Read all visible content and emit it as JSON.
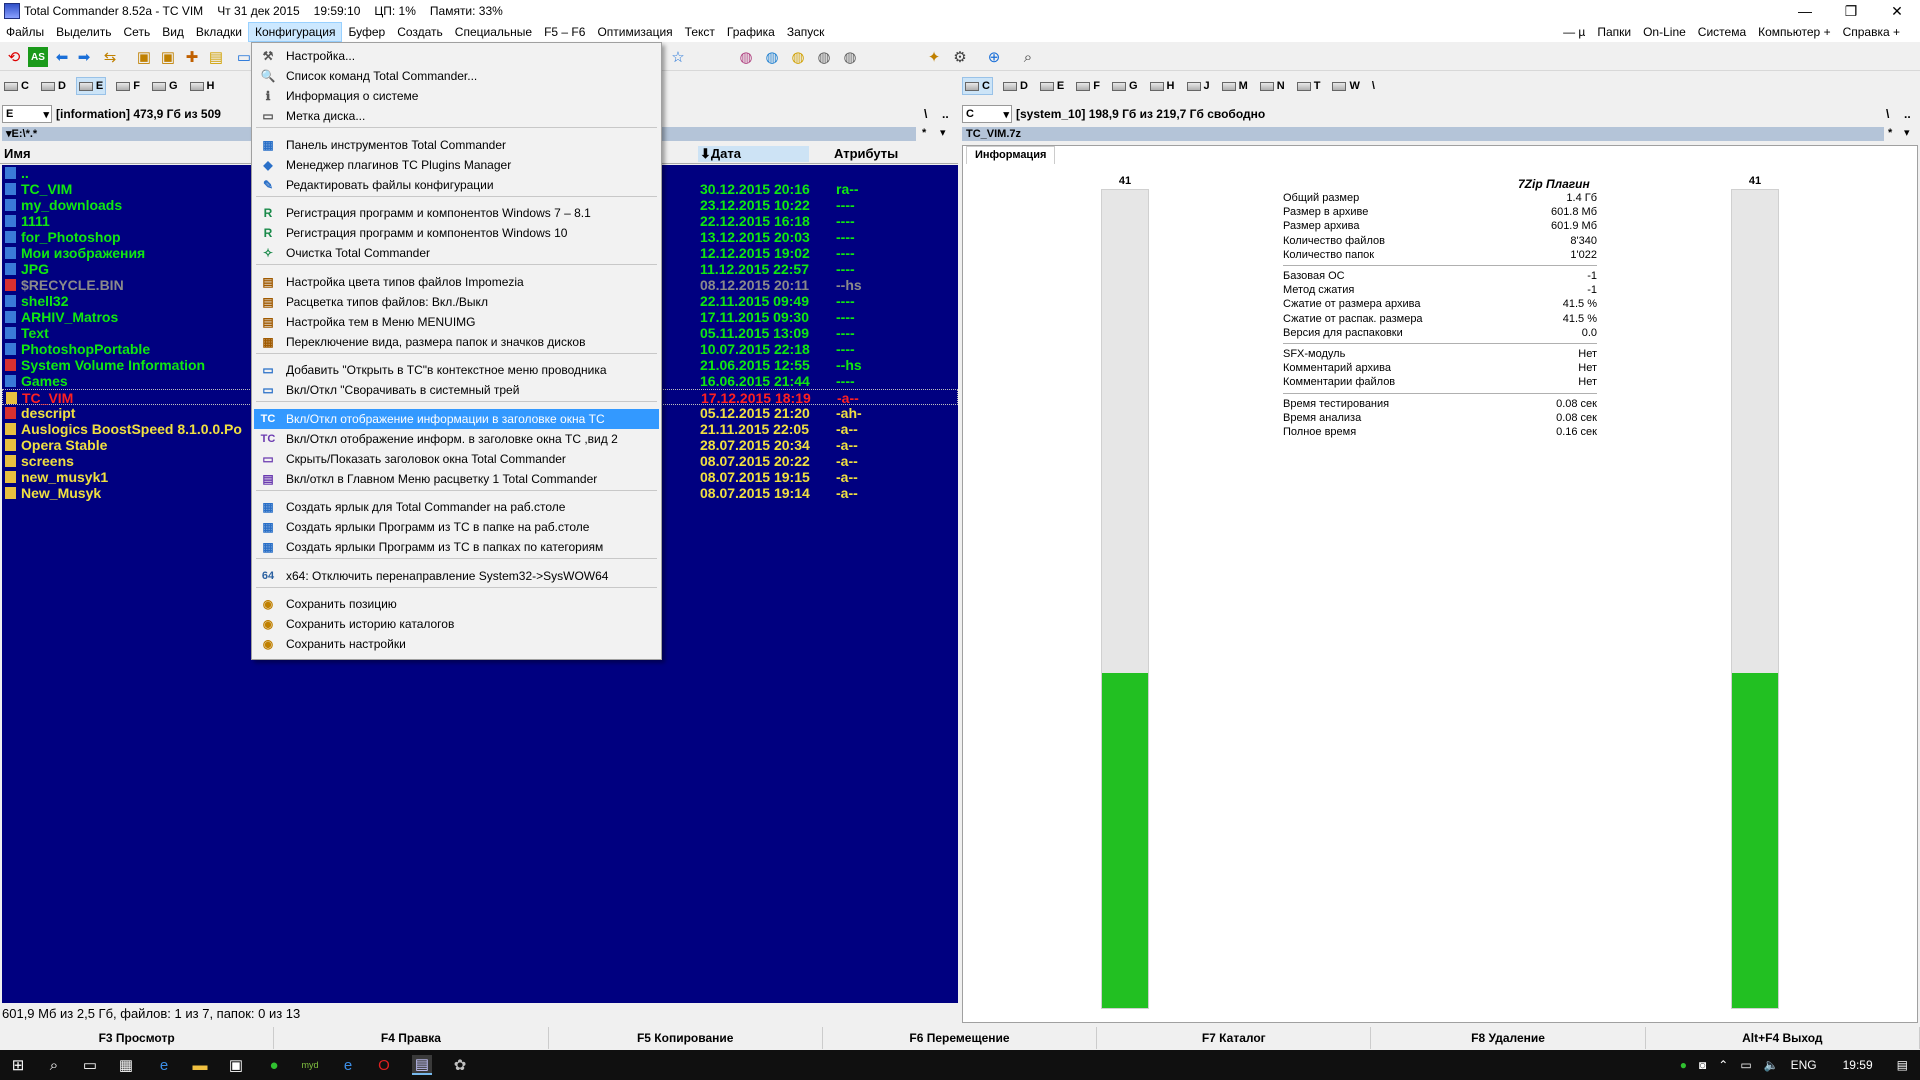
{
  "titlebar": {
    "title": "Total Commander 8.52a - TC VIM",
    "date": "Чт 31 дек 2015",
    "time": "19:59:10",
    "cpu": "ЦП: 1%",
    "memory": "Памяти: 33%",
    "minimize": "—",
    "restore": "❐",
    "close": "✕"
  },
  "menubar": {
    "items": [
      "Файлы",
      "Выделить",
      "Сеть",
      "Вид",
      "Вкладки",
      "Конфигурация",
      "Буфер",
      "Создать",
      "Специальные",
      "F5 – F6",
      "Оптимизация",
      "Текст",
      "Графика",
      "Запуск"
    ],
    "right": [
      "— µ",
      "Папки",
      "On-Line",
      "Система",
      "Компьютер +",
      "Справка +"
    ]
  },
  "left": {
    "drives": [
      "C",
      "D",
      "E",
      "F",
      "G",
      "H"
    ],
    "drive_select": "E",
    "volume_info": "[information]  473,9 Гб из 509",
    "path": "▾E:\\*.*",
    "root_btn": "\\",
    "up_btn": "..",
    "star": "*",
    "headers": {
      "name": "Имя",
      "date": "Дата",
      "attrs": "Атрибуты"
    },
    "files": [
      {
        "name": "..",
        "date": "",
        "attr": "",
        "color": "green",
        "icon": "up"
      },
      {
        "name": "TC_VIM",
        "date": "30.12.2015 20:16",
        "attr": "ra--",
        "color": "green",
        "icon": "folder"
      },
      {
        "name": "my_downloads",
        "date": "23.12.2015 10:22",
        "attr": "----",
        "color": "green",
        "icon": "folder"
      },
      {
        "name": "1111",
        "date": "22.12.2015 16:18",
        "attr": "----",
        "color": "green",
        "icon": "folder"
      },
      {
        "name": "for_Photoshop",
        "date": "13.12.2015 20:03",
        "attr": "----",
        "color": "green",
        "icon": "folder"
      },
      {
        "name": "Мои изображения",
        "date": "12.12.2015 19:02",
        "attr": "----",
        "color": "green",
        "icon": "folder"
      },
      {
        "name": "JPG",
        "date": "11.12.2015 22:57",
        "attr": "----",
        "color": "green",
        "icon": "folder"
      },
      {
        "name": "$RECYCLE.BIN",
        "date": "08.12.2015 20:11",
        "attr": "--hs",
        "color": "gray",
        "icon": "warn"
      },
      {
        "name": "shell32",
        "date": "22.11.2015 09:49",
        "attr": "----",
        "color": "green",
        "icon": "folder"
      },
      {
        "name": "ARHIV_Matros",
        "date": "17.11.2015 09:30",
        "attr": "----",
        "color": "green",
        "icon": "folder"
      },
      {
        "name": "Text",
        "date": "05.11.2015 13:09",
        "attr": "----",
        "color": "green",
        "icon": "folder"
      },
      {
        "name": "PhotoshopPortable",
        "date": "10.07.2015 22:18",
        "attr": "----",
        "color": "green",
        "icon": "folder"
      },
      {
        "name": "System Volume Information",
        "date": "21.06.2015 12:55",
        "attr": "--hs",
        "color": "green",
        "icon": "warn"
      },
      {
        "name": "Games",
        "date": "16.06.2015 21:44",
        "attr": "----",
        "color": "green",
        "icon": "folder"
      },
      {
        "name": "TC_VIM",
        "date": "17.12.2015 18:19",
        "attr": "-a--",
        "color": "red",
        "icon": "file"
      },
      {
        "name": "descript",
        "date": "05.12.2015 21:20",
        "attr": "-ah-",
        "color": "yellow",
        "icon": "warnfile"
      },
      {
        "name": "Auslogics BoostSpeed 8.1.0.0.Po",
        "date": "21.11.2015 22:05",
        "attr": "-a--",
        "color": "yellow",
        "icon": "file"
      },
      {
        "name": "Opera Stable",
        "date": "28.07.2015 20:34",
        "attr": "-a--",
        "color": "yellow",
        "icon": "file"
      },
      {
        "name": "screens",
        "date": "08.07.2015 20:22",
        "attr": "-a--",
        "color": "yellow",
        "icon": "file"
      },
      {
        "name": "new_musyk1",
        "date": "08.07.2015 19:15",
        "attr": "-a--",
        "color": "yellow",
        "icon": "file"
      },
      {
        "name": "New_Musyk",
        "date": "08.07.2015 19:14",
        "attr": "-a--",
        "color": "yellow",
        "icon": "file"
      }
    ],
    "status": "601,9 Мб из 2,5 Гб, файлов: 1 из 7, папок: 0 из 13"
  },
  "right": {
    "drives": [
      "C",
      "D",
      "E",
      "F",
      "G",
      "H",
      "J",
      "M",
      "N",
      "T",
      "W"
    ],
    "extra": "\\",
    "drive_select": "C",
    "volume_info": "[system_10]  198,9 Гб из 219,7 Гб свободно",
    "path": "TC_VIM.7z",
    "root_btn": "\\",
    "up_btn": "..",
    "star": "*",
    "tab": "Информация",
    "bar_left_label": "41",
    "bar_right_label": "41",
    "bar_fill_fraction": 0.41,
    "plugin_title": "7Zip Плагин",
    "group1": [
      {
        "k": "Общий размер",
        "v": "1.4 Гб"
      },
      {
        "k": "Размер в архиве",
        "v": "601.8 Мб"
      },
      {
        "k": "Размер архива",
        "v": "601.9 Мб"
      },
      {
        "k": "Количество файлов",
        "v": "8'340"
      },
      {
        "k": "Количество папок",
        "v": "1'022"
      }
    ],
    "group2": [
      {
        "k": "Базовая ОС",
        "v": "-1"
      },
      {
        "k": "Метод сжатия",
        "v": "-1"
      },
      {
        "k": "Сжатие от размера архива",
        "v": "41.5 %"
      },
      {
        "k": "Сжатие от распак. размера",
        "v": "41.5 %"
      },
      {
        "k": "Версия для распаковки",
        "v": "0.0"
      }
    ],
    "group3": [
      {
        "k": "SFX-модуль",
        "v": "Нет"
      },
      {
        "k": "Комментарий архива",
        "v": "Нет"
      },
      {
        "k": "Комментарии файлов",
        "v": "Нет"
      }
    ],
    "group4": [
      {
        "k": "Время тестирования",
        "v": "0.08 сек"
      },
      {
        "k": "Время анализа",
        "v": "0.08 сек"
      },
      {
        "k": "Полное время",
        "v": "0.16 сек"
      }
    ]
  },
  "dropdown": {
    "groups": [
      [
        {
          "label": "Настройка...",
          "icon": "⚒"
        },
        {
          "label": "Список команд Total Commander...",
          "icon": "🔍"
        },
        {
          "label": "Информация о системе",
          "icon": "ℹ"
        },
        {
          "label": "Метка диска...",
          "icon": "▭"
        }
      ],
      [
        {
          "label": "Панель инструментов Total Commander",
          "icon": "▦"
        },
        {
          "label": "Менеджер плагинов TC Plugins Manager",
          "icon": "◆"
        },
        {
          "label": "Редактировать файлы конфигурации",
          "icon": "✎"
        }
      ],
      [
        {
          "label": "Регистрация программ и компонентов Windows 7 – 8.1",
          "icon": "R"
        },
        {
          "label": "Регистрация программ и компонентов Windows 10",
          "icon": "R"
        },
        {
          "label": "Очистка Total Commander",
          "icon": "✧"
        }
      ],
      [
        {
          "label": "Настройка цвета типов файлов Impomezia",
          "icon": "▤"
        },
        {
          "label": "Расцветка типов файлов: Вкл./Выкл",
          "icon": "▤"
        },
        {
          "label": "Настройка тем в Меню MENUIMG",
          "icon": "▤"
        },
        {
          "label": "Переключение вида, размера папок и значков дисков",
          "icon": "▦"
        }
      ],
      [
        {
          "label": "Добавить \"Открыть в TC\"в контекстное меню проводника",
          "icon": "▭"
        },
        {
          "label": "Вкл/Откл \"Сворачивать в системный трей",
          "icon": "▭"
        }
      ],
      [
        {
          "label": "Вкл/Откл отображение информации в заголовке окна TC",
          "icon": "TC",
          "highlight": true
        },
        {
          "label": "Вкл/Откл отображение информ. в заголовке окна TC ,вид 2",
          "icon": "TC"
        },
        {
          "label": "Скрыть/Показать заголовок окна Total Commander",
          "icon": "▭"
        },
        {
          "label": "Вкл/откл в Главном Меню расцветку 1 Total Commander",
          "icon": "▤"
        }
      ],
      [
        {
          "label": "Создать ярлык для Total Commander на раб.столе",
          "icon": "▦"
        },
        {
          "label": "Создать ярлыки Программ из TC в папке на раб.столе",
          "icon": "▦"
        },
        {
          "label": "Создать ярлыки Программ из TC в папках по категориям",
          "icon": "▦"
        }
      ],
      [
        {
          "label": "x64: Отключить перенаправление System32->SysWOW64",
          "icon": "64"
        }
      ],
      [
        {
          "label": "Сохранить позицию",
          "icon": "◉"
        },
        {
          "label": "Сохранить историю каталогов",
          "icon": "◉"
        },
        {
          "label": "Сохранить настройки",
          "icon": "◉"
        }
      ]
    ]
  },
  "fkeys": [
    "F3 Просмотр",
    "F4 Правка",
    "F5 Копирование",
    "F6 Перемещение",
    "F7 Каталог",
    "F8 Удаление",
    "Alt+F4 Выход"
  ],
  "tray": {
    "lang": "ENG",
    "time": "19:59"
  },
  "colors": {
    "panel_bg": "#000080",
    "folder_text": "#10e810",
    "file_text": "#f0e040",
    "hidden_text": "#8a8a8a",
    "cursor_text": "#ff2020",
    "highlight": "#3399ff",
    "bar_fill": "#22c022"
  }
}
